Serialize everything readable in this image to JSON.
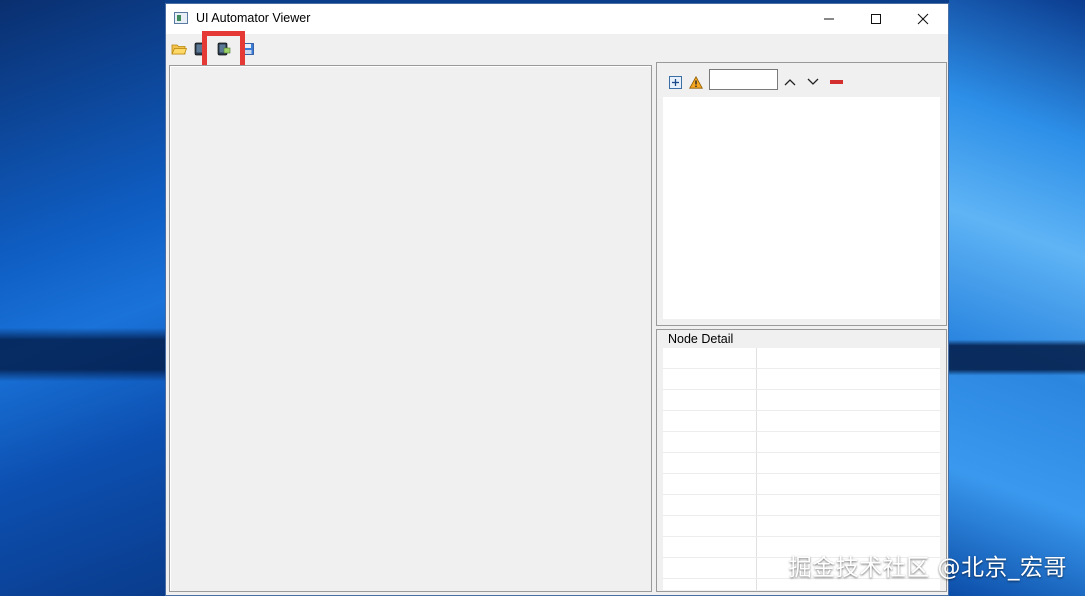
{
  "window": {
    "title": "UI Automator Viewer",
    "controls": {
      "minimize": "—",
      "maximize": "☐",
      "close": "✕"
    }
  },
  "toolbar": {
    "items": [
      {
        "icon": "open-folder-icon"
      },
      {
        "icon": "device-screenshot-icon"
      },
      {
        "icon": "device-screenshot-compressed-icon",
        "highlighted": true
      },
      {
        "icon": "save-icon"
      }
    ],
    "highlight_color": "#e53935"
  },
  "tree_panel": {
    "toolbar": {
      "expand_icon": "expand-all-icon",
      "warning_icon": "warning-icon",
      "search_value": "",
      "prev_icon": "chevron-up-icon",
      "next_icon": "chevron-down-icon",
      "clear_icon": "minus-icon"
    }
  },
  "node_detail": {
    "label": "Node Detail",
    "rows": 12
  },
  "watermark": "掘金技术社区 @北京_宏哥",
  "colors": {
    "window_bg": "#f0f0f0",
    "desktop_blue": "#0b5bc7",
    "warning": "#f5a623",
    "clear_red": "#d32f2f"
  }
}
